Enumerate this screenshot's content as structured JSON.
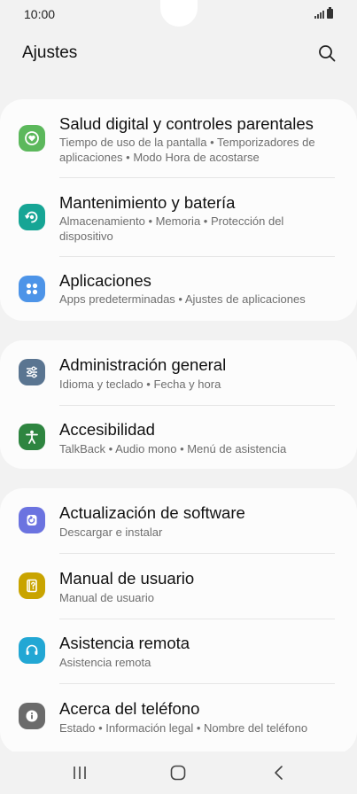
{
  "status_bar": {
    "time": "10:00"
  },
  "header": {
    "title": "Ajustes"
  },
  "groups": [
    {
      "items": [
        {
          "title": "Salud digital y controles parentales",
          "subtitle": "Tiempo de uso de la pantalla • Temporizadores de aplicaciones • Modo Hora de acostarse",
          "icon": "digital-wellbeing-icon",
          "color": "#5cb85c"
        },
        {
          "title": "Mantenimiento y batería",
          "subtitle": "Almacenamiento • Memoria • Protección del dispositivo",
          "icon": "device-care-icon",
          "color": "#16a595"
        },
        {
          "title": "Aplicaciones",
          "subtitle": "Apps predeterminadas • Ajustes de aplicaciones",
          "icon": "apps-icon",
          "color": "#4d94e8"
        }
      ]
    },
    {
      "items": [
        {
          "title": "Administración general",
          "subtitle": "Idioma y teclado • Fecha y hora",
          "icon": "general-management-icon",
          "color": "#5a7591"
        },
        {
          "title": "Accesibilidad",
          "subtitle": "TalkBack • Audio mono • Menú de asistencia",
          "icon": "accessibility-icon",
          "color": "#2e8540"
        }
      ]
    },
    {
      "items": [
        {
          "title": "Actualización de software",
          "subtitle": "Descargar e instalar",
          "icon": "software-update-icon",
          "color": "#6b73e0"
        },
        {
          "title": "Manual de usuario",
          "subtitle": "Manual de usuario",
          "icon": "user-manual-icon",
          "color": "#c9a400"
        },
        {
          "title": "Asistencia remota",
          "subtitle": "Asistencia remota",
          "icon": "remote-support-icon",
          "color": "#22a7d4"
        },
        {
          "title": "Acerca del teléfono",
          "subtitle": "Estado • Información legal • Nombre del teléfono",
          "icon": "about-phone-icon",
          "color": "#6b6b6b"
        }
      ]
    }
  ]
}
